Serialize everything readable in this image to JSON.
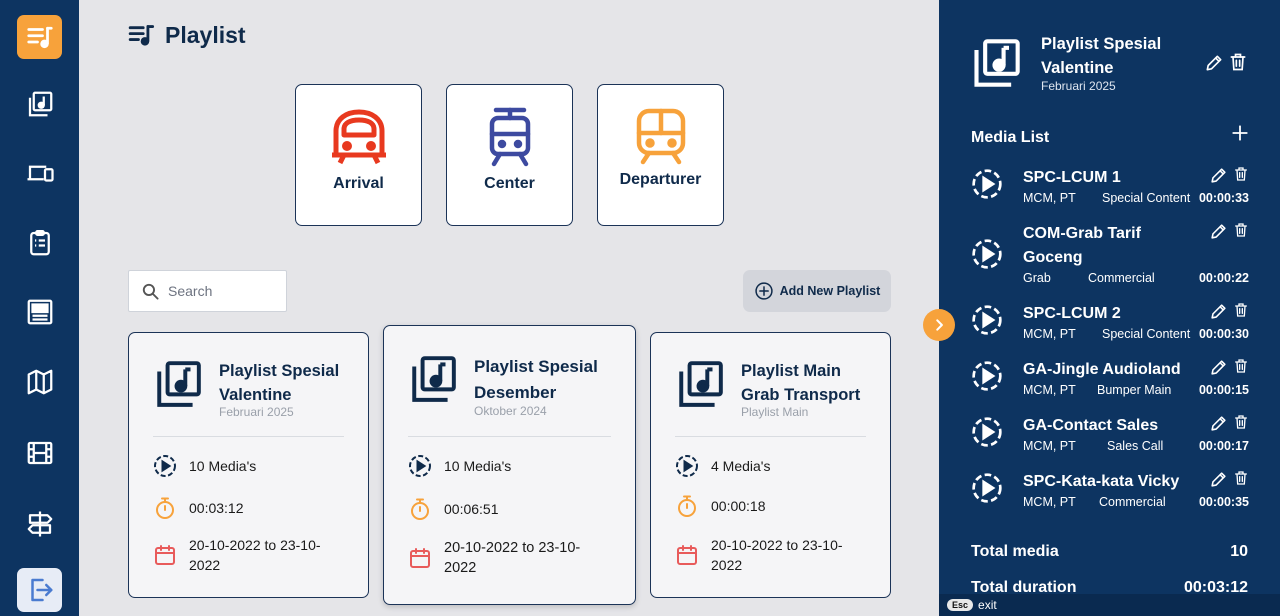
{
  "main": {
    "title": "Playlist",
    "categories": [
      {
        "label": "Arrival",
        "color": "#e8391f"
      },
      {
        "label": "Center",
        "color": "#3d4aa0"
      },
      {
        "label": "Departurer",
        "color": "#f7a23b"
      }
    ],
    "search": {
      "placeholder": "Search"
    },
    "add_button": "Add New Playlist",
    "cards": [
      {
        "title_line1": "Playlist Spesial",
        "title_line2": "Valentine",
        "subtitle": "Februari 2025",
        "media_count": "10 Media's",
        "duration": "00:03:12",
        "date_line1": "20-10-2022 to 23-10-",
        "date_line2": "2022"
      },
      {
        "title_line1": "Playlist Spesial",
        "title_line2": "Desember",
        "subtitle": "Oktober 2024",
        "media_count": "10 Media's",
        "duration": "00:06:51",
        "date_line1": "20-10-2022 to 23-10-",
        "date_line2": "2022"
      },
      {
        "title_line1": "Playlist Main",
        "title_line2": "Grab Transport",
        "subtitle": "Playlist Main",
        "media_count": "4 Media's",
        "duration": "00:00:18",
        "date_line1": "20-10-2022 to 23-10-",
        "date_line2": "2022"
      }
    ]
  },
  "panel": {
    "title_line1": "Playlist Spesial",
    "title_line2": "Valentine",
    "subtitle": "Februari 2025",
    "media_list_label": "Media List",
    "media": [
      {
        "name": "SPC-LCUM 1",
        "source": "MCM, PT",
        "type": "Special Content",
        "duration": "00:00:33"
      },
      {
        "name": "COM-Grab Tarif Goceng",
        "source": "Grab",
        "type": "Commercial",
        "duration": "00:00:22"
      },
      {
        "name": "SPC-LCUM 2",
        "source": "MCM, PT",
        "type": "Special Content",
        "duration": "00:00:30"
      },
      {
        "name": "GA-Jingle Audioland",
        "source": "MCM, PT",
        "type": "Bumper Main",
        "duration": "00:00:15"
      },
      {
        "name": "GA-Contact Sales",
        "source": "MCM, PT",
        "type": "Sales Call",
        "duration": "00:00:17"
      },
      {
        "name": "SPC-Kata-kata Vicky",
        "source": "MCM, PT",
        "type": "Commercial",
        "duration": "00:00:35"
      }
    ],
    "total_media_label": "Total media",
    "total_media_value": "10",
    "total_duration_label": "Total duration",
    "total_duration_value": "00:03:12"
  },
  "hint": {
    "key": "Esc",
    "label": "exit"
  },
  "colors": {
    "sidebar": "#0d3461",
    "accent": "#f7a23b",
    "danger": "#e8391f",
    "navy": "#3d4aa0"
  }
}
